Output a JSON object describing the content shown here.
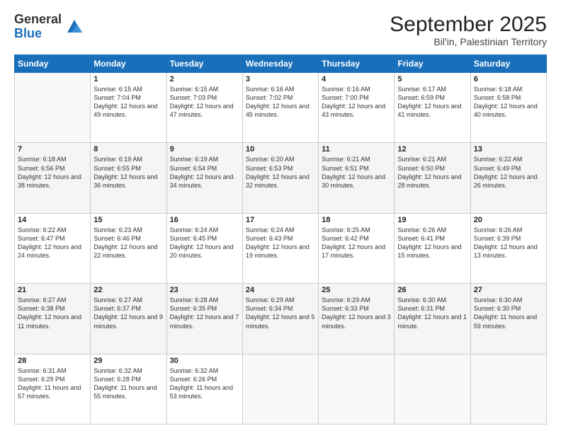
{
  "logo": {
    "general": "General",
    "blue": "Blue"
  },
  "header": {
    "month": "September 2025",
    "location": "Bil'in, Palestinian Territory"
  },
  "days": [
    "Sunday",
    "Monday",
    "Tuesday",
    "Wednesday",
    "Thursday",
    "Friday",
    "Saturday"
  ],
  "weeks": [
    [
      {
        "day": "",
        "sunrise": "",
        "sunset": "",
        "daylight": ""
      },
      {
        "day": "1",
        "sunrise": "Sunrise: 6:15 AM",
        "sunset": "Sunset: 7:04 PM",
        "daylight": "Daylight: 12 hours and 49 minutes."
      },
      {
        "day": "2",
        "sunrise": "Sunrise: 6:15 AM",
        "sunset": "Sunset: 7:03 PM",
        "daylight": "Daylight: 12 hours and 47 minutes."
      },
      {
        "day": "3",
        "sunrise": "Sunrise: 6:16 AM",
        "sunset": "Sunset: 7:02 PM",
        "daylight": "Daylight: 12 hours and 45 minutes."
      },
      {
        "day": "4",
        "sunrise": "Sunrise: 6:16 AM",
        "sunset": "Sunset: 7:00 PM",
        "daylight": "Daylight: 12 hours and 43 minutes."
      },
      {
        "day": "5",
        "sunrise": "Sunrise: 6:17 AM",
        "sunset": "Sunset: 6:59 PM",
        "daylight": "Daylight: 12 hours and 41 minutes."
      },
      {
        "day": "6",
        "sunrise": "Sunrise: 6:18 AM",
        "sunset": "Sunset: 6:58 PM",
        "daylight": "Daylight: 12 hours and 40 minutes."
      }
    ],
    [
      {
        "day": "7",
        "sunrise": "Sunrise: 6:18 AM",
        "sunset": "Sunset: 6:56 PM",
        "daylight": "Daylight: 12 hours and 38 minutes."
      },
      {
        "day": "8",
        "sunrise": "Sunrise: 6:19 AM",
        "sunset": "Sunset: 6:55 PM",
        "daylight": "Daylight: 12 hours and 36 minutes."
      },
      {
        "day": "9",
        "sunrise": "Sunrise: 6:19 AM",
        "sunset": "Sunset: 6:54 PM",
        "daylight": "Daylight: 12 hours and 34 minutes."
      },
      {
        "day": "10",
        "sunrise": "Sunrise: 6:20 AM",
        "sunset": "Sunset: 6:53 PM",
        "daylight": "Daylight: 12 hours and 32 minutes."
      },
      {
        "day": "11",
        "sunrise": "Sunrise: 6:21 AM",
        "sunset": "Sunset: 6:51 PM",
        "daylight": "Daylight: 12 hours and 30 minutes."
      },
      {
        "day": "12",
        "sunrise": "Sunrise: 6:21 AM",
        "sunset": "Sunset: 6:50 PM",
        "daylight": "Daylight: 12 hours and 28 minutes."
      },
      {
        "day": "13",
        "sunrise": "Sunrise: 6:22 AM",
        "sunset": "Sunset: 6:49 PM",
        "daylight": "Daylight: 12 hours and 26 minutes."
      }
    ],
    [
      {
        "day": "14",
        "sunrise": "Sunrise: 6:22 AM",
        "sunset": "Sunset: 6:47 PM",
        "daylight": "Daylight: 12 hours and 24 minutes."
      },
      {
        "day": "15",
        "sunrise": "Sunrise: 6:23 AM",
        "sunset": "Sunset: 6:46 PM",
        "daylight": "Daylight: 12 hours and 22 minutes."
      },
      {
        "day": "16",
        "sunrise": "Sunrise: 6:24 AM",
        "sunset": "Sunset: 6:45 PM",
        "daylight": "Daylight: 12 hours and 20 minutes."
      },
      {
        "day": "17",
        "sunrise": "Sunrise: 6:24 AM",
        "sunset": "Sunset: 6:43 PM",
        "daylight": "Daylight: 12 hours and 19 minutes."
      },
      {
        "day": "18",
        "sunrise": "Sunrise: 6:25 AM",
        "sunset": "Sunset: 6:42 PM",
        "daylight": "Daylight: 12 hours and 17 minutes."
      },
      {
        "day": "19",
        "sunrise": "Sunrise: 6:26 AM",
        "sunset": "Sunset: 6:41 PM",
        "daylight": "Daylight: 12 hours and 15 minutes."
      },
      {
        "day": "20",
        "sunrise": "Sunrise: 6:26 AM",
        "sunset": "Sunset: 6:39 PM",
        "daylight": "Daylight: 12 hours and 13 minutes."
      }
    ],
    [
      {
        "day": "21",
        "sunrise": "Sunrise: 6:27 AM",
        "sunset": "Sunset: 6:38 PM",
        "daylight": "Daylight: 12 hours and 11 minutes."
      },
      {
        "day": "22",
        "sunrise": "Sunrise: 6:27 AM",
        "sunset": "Sunset: 6:37 PM",
        "daylight": "Daylight: 12 hours and 9 minutes."
      },
      {
        "day": "23",
        "sunrise": "Sunrise: 6:28 AM",
        "sunset": "Sunset: 6:35 PM",
        "daylight": "Daylight: 12 hours and 7 minutes."
      },
      {
        "day": "24",
        "sunrise": "Sunrise: 6:29 AM",
        "sunset": "Sunset: 6:34 PM",
        "daylight": "Daylight: 12 hours and 5 minutes."
      },
      {
        "day": "25",
        "sunrise": "Sunrise: 6:29 AM",
        "sunset": "Sunset: 6:33 PM",
        "daylight": "Daylight: 12 hours and 3 minutes."
      },
      {
        "day": "26",
        "sunrise": "Sunrise: 6:30 AM",
        "sunset": "Sunset: 6:31 PM",
        "daylight": "Daylight: 12 hours and 1 minute."
      },
      {
        "day": "27",
        "sunrise": "Sunrise: 6:30 AM",
        "sunset": "Sunset: 6:30 PM",
        "daylight": "Daylight: 11 hours and 59 minutes."
      }
    ],
    [
      {
        "day": "28",
        "sunrise": "Sunrise: 6:31 AM",
        "sunset": "Sunset: 6:29 PM",
        "daylight": "Daylight: 11 hours and 57 minutes."
      },
      {
        "day": "29",
        "sunrise": "Sunrise: 6:32 AM",
        "sunset": "Sunset: 6:28 PM",
        "daylight": "Daylight: 11 hours and 55 minutes."
      },
      {
        "day": "30",
        "sunrise": "Sunrise: 6:32 AM",
        "sunset": "Sunset: 6:26 PM",
        "daylight": "Daylight: 11 hours and 53 minutes."
      },
      {
        "day": "",
        "sunrise": "",
        "sunset": "",
        "daylight": ""
      },
      {
        "day": "",
        "sunrise": "",
        "sunset": "",
        "daylight": ""
      },
      {
        "day": "",
        "sunrise": "",
        "sunset": "",
        "daylight": ""
      },
      {
        "day": "",
        "sunrise": "",
        "sunset": "",
        "daylight": ""
      }
    ]
  ]
}
